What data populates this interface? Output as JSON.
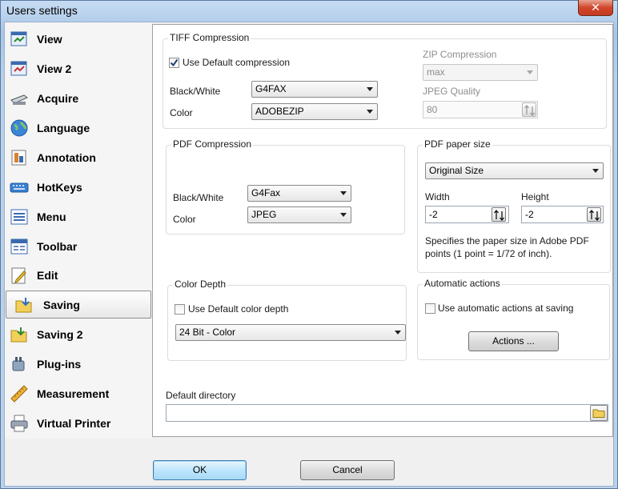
{
  "window": {
    "title": "Users settings",
    "close_glyph": "✕"
  },
  "sidebar": {
    "items": [
      {
        "label": "View",
        "icon": "view-icon"
      },
      {
        "label": "View 2",
        "icon": "view2-icon"
      },
      {
        "label": "Acquire",
        "icon": "scanner-icon"
      },
      {
        "label": "Language",
        "icon": "globe-icon"
      },
      {
        "label": "Annotation",
        "icon": "annotation-icon"
      },
      {
        "label": "HotKeys",
        "icon": "keyboard-icon"
      },
      {
        "label": "Menu",
        "icon": "menu-icon"
      },
      {
        "label": "Toolbar",
        "icon": "toolbar-icon"
      },
      {
        "label": "Edit",
        "icon": "edit-icon"
      },
      {
        "label": "Saving",
        "icon": "folder-save-icon",
        "active": true
      },
      {
        "label": "Saving 2",
        "icon": "folder-save2-icon"
      },
      {
        "label": "Plug-ins",
        "icon": "plugin-icon"
      },
      {
        "label": "Measurement",
        "icon": "ruler-icon"
      },
      {
        "label": "Virtual Printer",
        "icon": "printer-icon"
      }
    ]
  },
  "tiff": {
    "title": "TIFF Compression",
    "use_default_label": "Use Default compression",
    "use_default_checked": true,
    "bw_label": "Black/White",
    "bw_value": "G4FAX",
    "color_label": "Color",
    "color_value": "ADOBEZIP",
    "zip_label": "ZIP Compression",
    "zip_value": "max",
    "jpeg_label": "JPEG Quality",
    "jpeg_value": "80"
  },
  "pdf": {
    "title": "PDF Compression",
    "bw_label": "Black/White",
    "bw_value": "G4Fax",
    "color_label": "Color",
    "color_value": "JPEG"
  },
  "paper": {
    "title": "PDF paper size",
    "size_value": "Original Size",
    "width_label": "Width",
    "width_value": "-2",
    "height_label": "Height",
    "height_value": "-2",
    "description_line1": "Specifies the paper size in Adobe PDF",
    "description_line2": "points (1 point = 1/72 of inch)."
  },
  "depth": {
    "title": "Color Depth",
    "use_default_label": "Use Default color depth",
    "use_default_checked": false,
    "value": "24 Bit - Color"
  },
  "auto": {
    "title": "Automatic actions",
    "use_label": "Use automatic actions at saving",
    "use_checked": false,
    "actions_label": "Actions ..."
  },
  "directory": {
    "label": "Default directory",
    "value": ""
  },
  "footer": {
    "ok_label": "OK",
    "cancel_label": "Cancel"
  },
  "colors": {
    "accent": "#3c7fb1",
    "check": "#1f3f74"
  }
}
